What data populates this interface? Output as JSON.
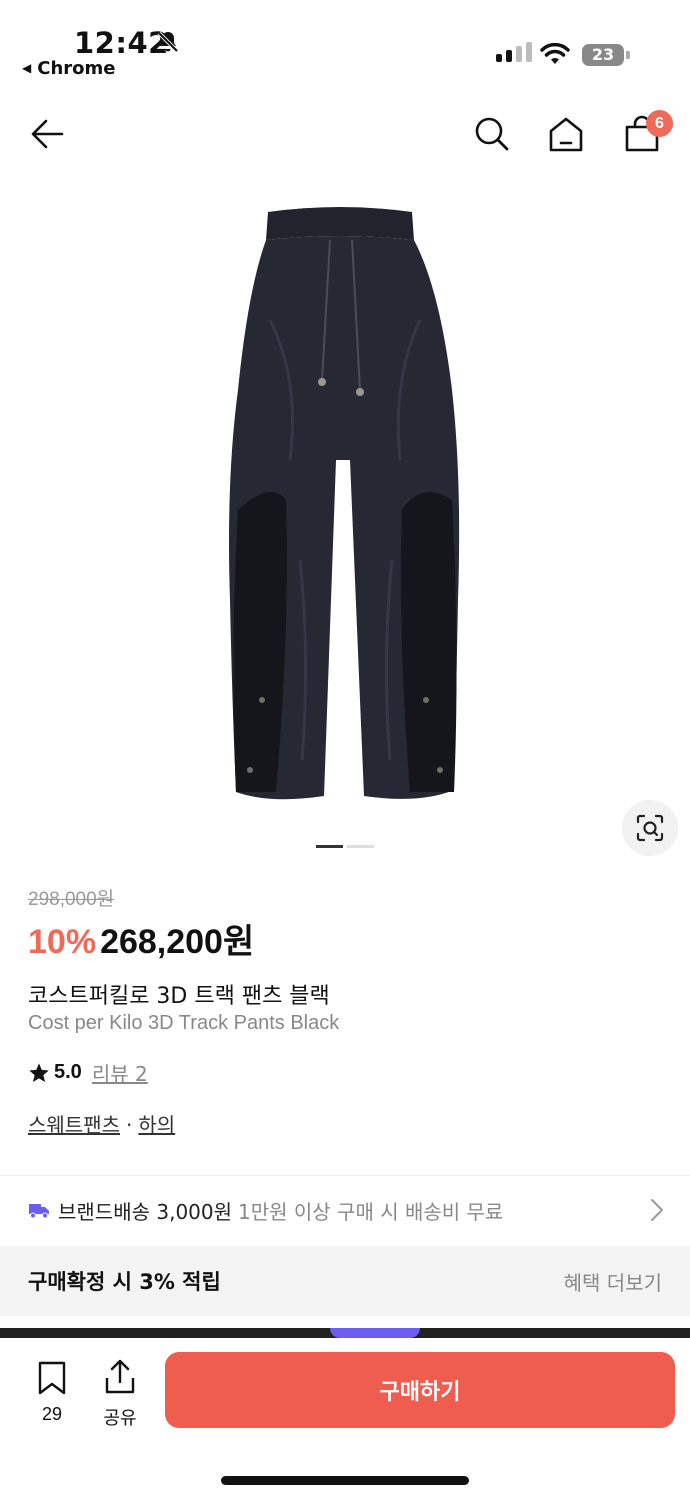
{
  "status": {
    "time": "12:42",
    "back_app": "Chrome",
    "battery": "23"
  },
  "nav": {
    "cart_count": "6",
    "icons": [
      "back-arrow-icon",
      "search-icon",
      "home-icon",
      "cart-icon"
    ]
  },
  "product": {
    "original_price": "298,000원",
    "discount": "10%",
    "price": "268,200원",
    "name_ko": "코스트퍼킬로 3D 트랙 팬츠 블랙",
    "name_en": "Cost per Kilo 3D Track Pants Black",
    "rating": "5.0",
    "review": "리뷰 2",
    "category_1": "스웨트팬츠",
    "category_sep": "·",
    "category_2": "하의",
    "image_count": 2,
    "image_index": 1
  },
  "shipping": {
    "label": "브랜드배송 3,000원",
    "note": "1만원 이상 구매 시 배송비 무료"
  },
  "benefit": {
    "title": "구매확정 시 3% 적립",
    "link": "혜택 더보기"
  },
  "bottom": {
    "bookmark_count": "29",
    "share_label": "공유",
    "buy_label": "구매하기"
  },
  "colors": {
    "accent": "#ef5d4f",
    "discount": "#f06a5a",
    "shipping_icon": "#6b5cf2"
  }
}
